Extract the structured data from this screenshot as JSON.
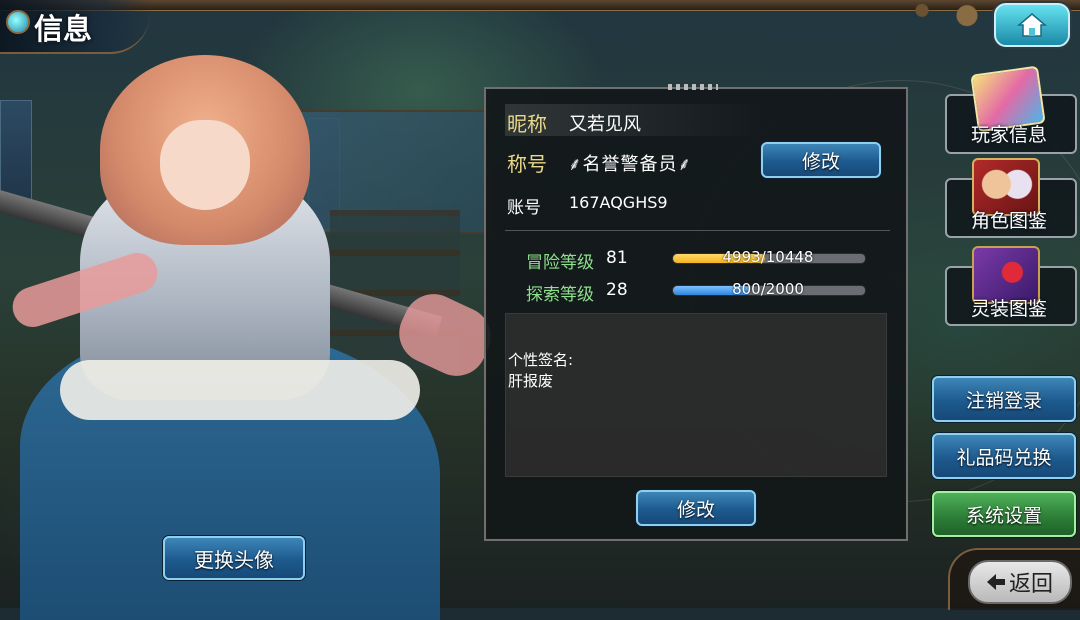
{
  "header": {
    "title": "信息",
    "home_icon": "home-icon"
  },
  "profile": {
    "nickname_label": "昵称",
    "nickname_value": "又若见风",
    "title_label": "称号",
    "title_value": "名誉警备员",
    "edit_title_button": "修改",
    "account_label": "账号",
    "account_value": "167AQGHS9"
  },
  "stats": {
    "adventure": {
      "label": "冒险等级",
      "level": "81",
      "progress_text": "4993/10448",
      "progress": 0.478,
      "color": "#f2b41e"
    },
    "explore": {
      "label": "探索等级",
      "level": "28",
      "progress_text": "800/2000",
      "progress": 0.4,
      "color": "#2f86e0"
    }
  },
  "signature": {
    "label": "个性签名:",
    "text": "肝报废",
    "edit_button": "修改"
  },
  "left": {
    "change_avatar_button": "更换头像"
  },
  "side_menu": {
    "player_info": "玩家信息",
    "character_book": "角色图鉴",
    "equipment_book": "灵装图鉴",
    "logout": "注销登录",
    "gift_code": "礼品码兑换",
    "settings": "系统设置"
  },
  "footer": {
    "back_button": "返回",
    "back_icon": "arrow-left-icon"
  }
}
